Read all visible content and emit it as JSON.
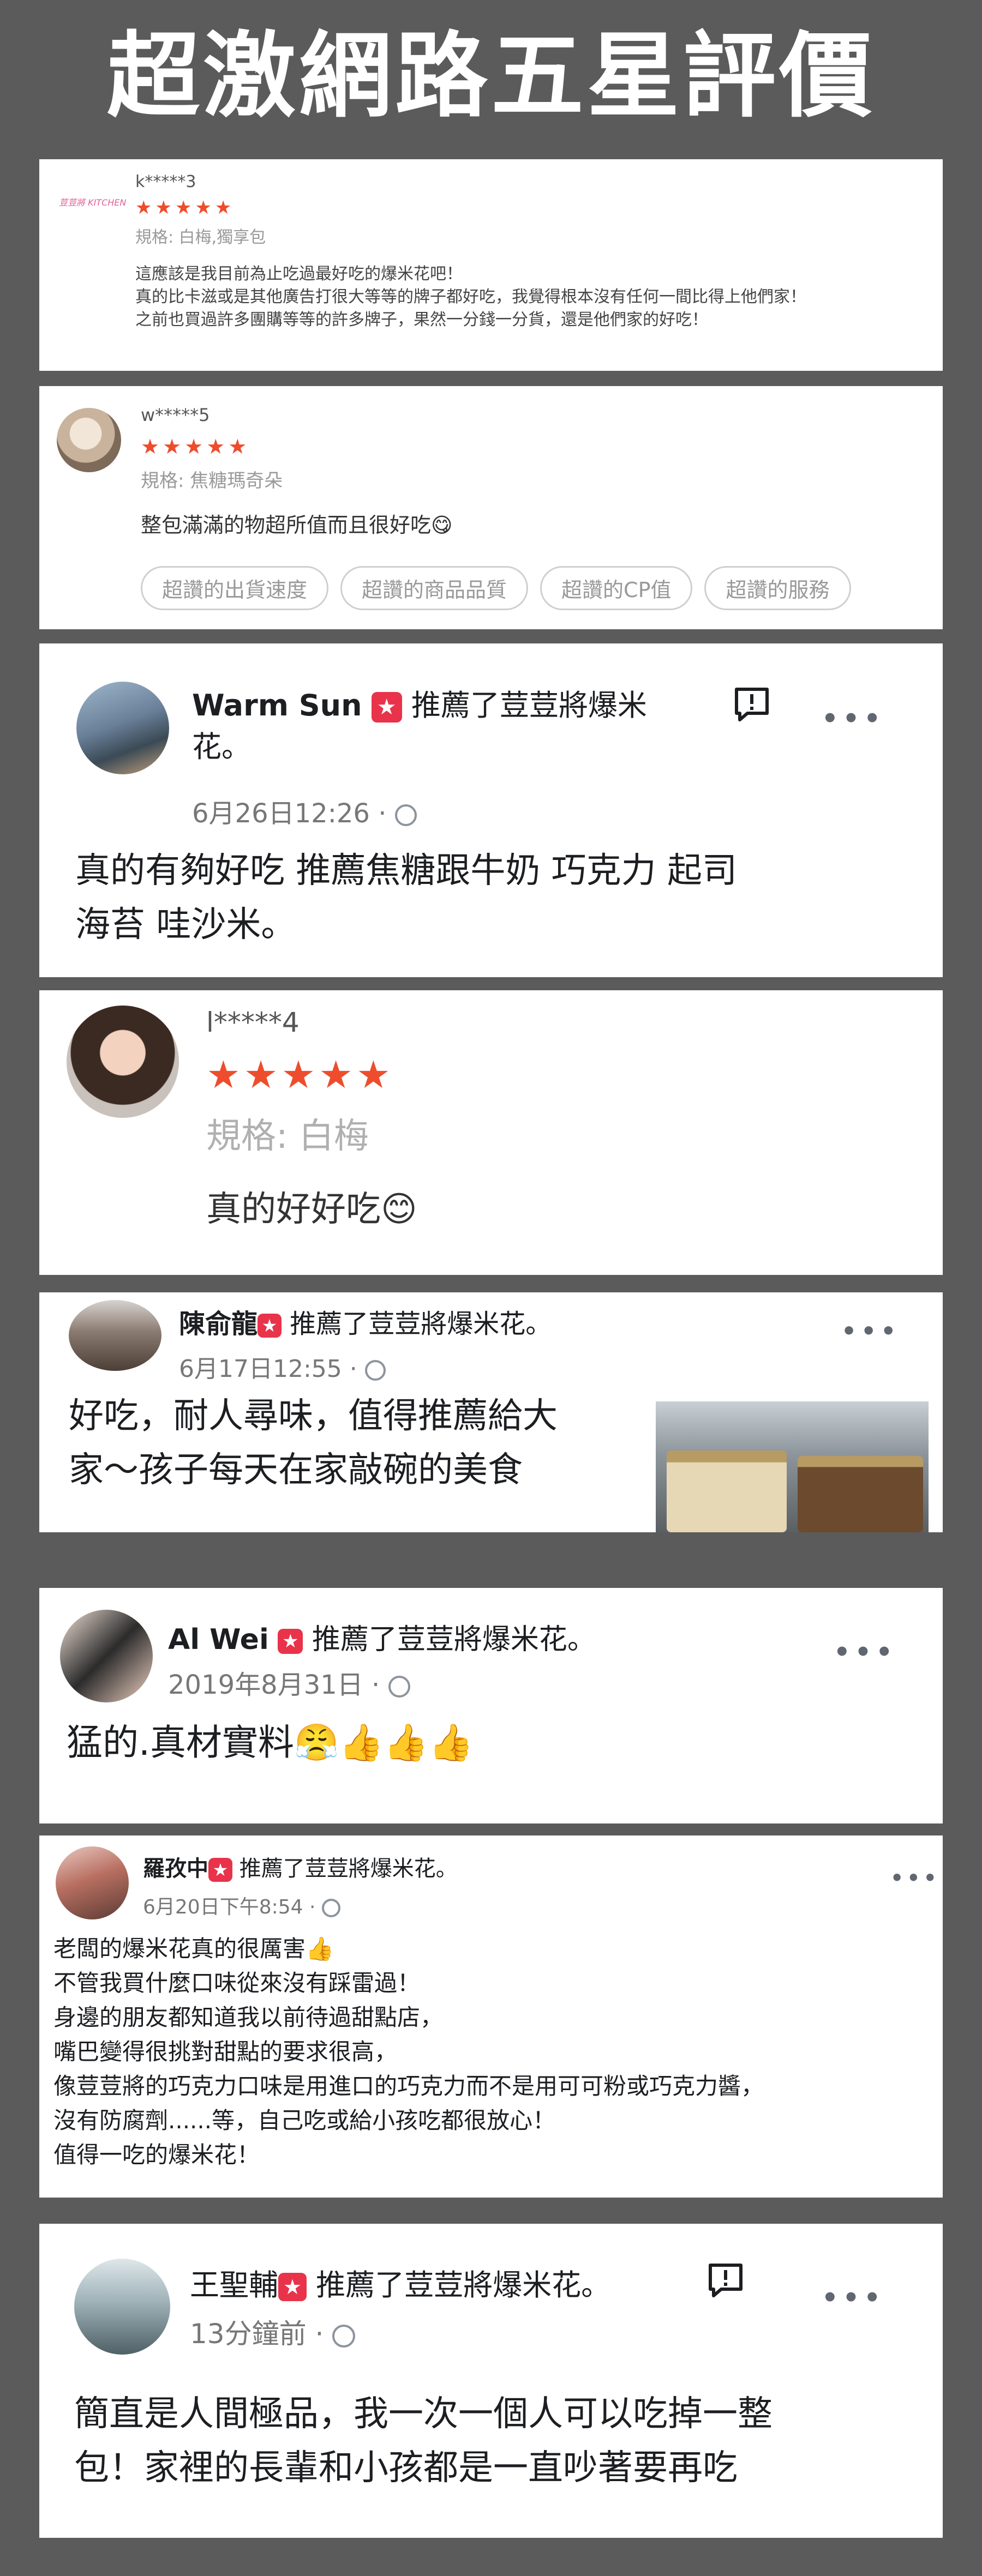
{
  "title": "超激網路五星評價",
  "reviews": [
    {
      "user": "k*****3",
      "logo_text": "荳荳將 KITCHEN",
      "stars": "★★★★★",
      "spec": "規格: 白梅,獨享包",
      "text": "這應該是我目前為止吃過最好吃的爆米花吧！\n真的比卡滋或是其他廣告打很大等等的牌子都好吃，我覺得根本沒有任何一間比得上他們家！\n之前也買過許多團購等等的許多牌子，果然一分錢一分貨，還是他們家的好吃！"
    },
    {
      "user": "w*****5",
      "stars": "★★★★★",
      "spec": "規格: 焦糖瑪奇朵",
      "text": "整包滿滿的物超所值而且很好吃😋",
      "tags": [
        "超讚的出貨速度",
        "超讚的商品品質",
        "超讚的CP值",
        "超讚的服務"
      ]
    },
    {
      "name": "Warm Sun",
      "recommend_line1": "推薦了荳荳將爆米",
      "recommend_line2": "花。",
      "date": "6月26日12:26 · ",
      "text": "真的有夠好吃  推薦焦糖跟牛奶 巧克力 起司\n海苔 哇沙米。"
    },
    {
      "user": "l*****4",
      "stars": "★★★★★",
      "spec": "規格: 白梅",
      "text": "真的好好吃😊"
    },
    {
      "name": "陳俞龍",
      "recommend": "推薦了荳荳將爆米花。",
      "date": "6月17日12:55 · ",
      "text": "好吃，耐人尋味，值得推薦給大\n家～孩子每天在家敲碗的美食"
    },
    {
      "name": "Al Wei",
      "recommend": "推薦了荳荳將爆米花。",
      "date": "2019年8月31日 · ",
      "text": "猛的.真材實料😤👍👍👍"
    },
    {
      "name": "羅孜中",
      "recommend": "推薦了荳荳將爆米花。",
      "date": "6月20日下午8:54 · ",
      "text": "老闆的爆米花真的很厲害👍\n不管我買什麼口味從來沒有踩雷過！\n身邊的朋友都知道我以前待過甜點店，\n嘴巴變得很挑對甜點的要求很高，\n像荳荳將的巧克力口味是用進口的巧克力而不是用可可粉或巧克力醬，\n沒有防腐劑......等，自己吃或給小孩吃都很放心！\n值得一吃的爆米花！"
    },
    {
      "name": "王聖輔",
      "recommend": "推薦了荳荳將爆米花。",
      "date": "13分鐘前 · ",
      "text": "簡直是人間極品，我一次一個人可以吃掉一整\n包！家裡的長輩和小孩都是一直吵著要再吃"
    }
  ],
  "colors": {
    "background": "#5b5b5b",
    "star": "#ee4d2d",
    "badge": "#e8334a"
  },
  "icons": [
    "star-icon",
    "recommend-badge-icon",
    "globe-icon",
    "more-options-icon",
    "comment-icon"
  ]
}
